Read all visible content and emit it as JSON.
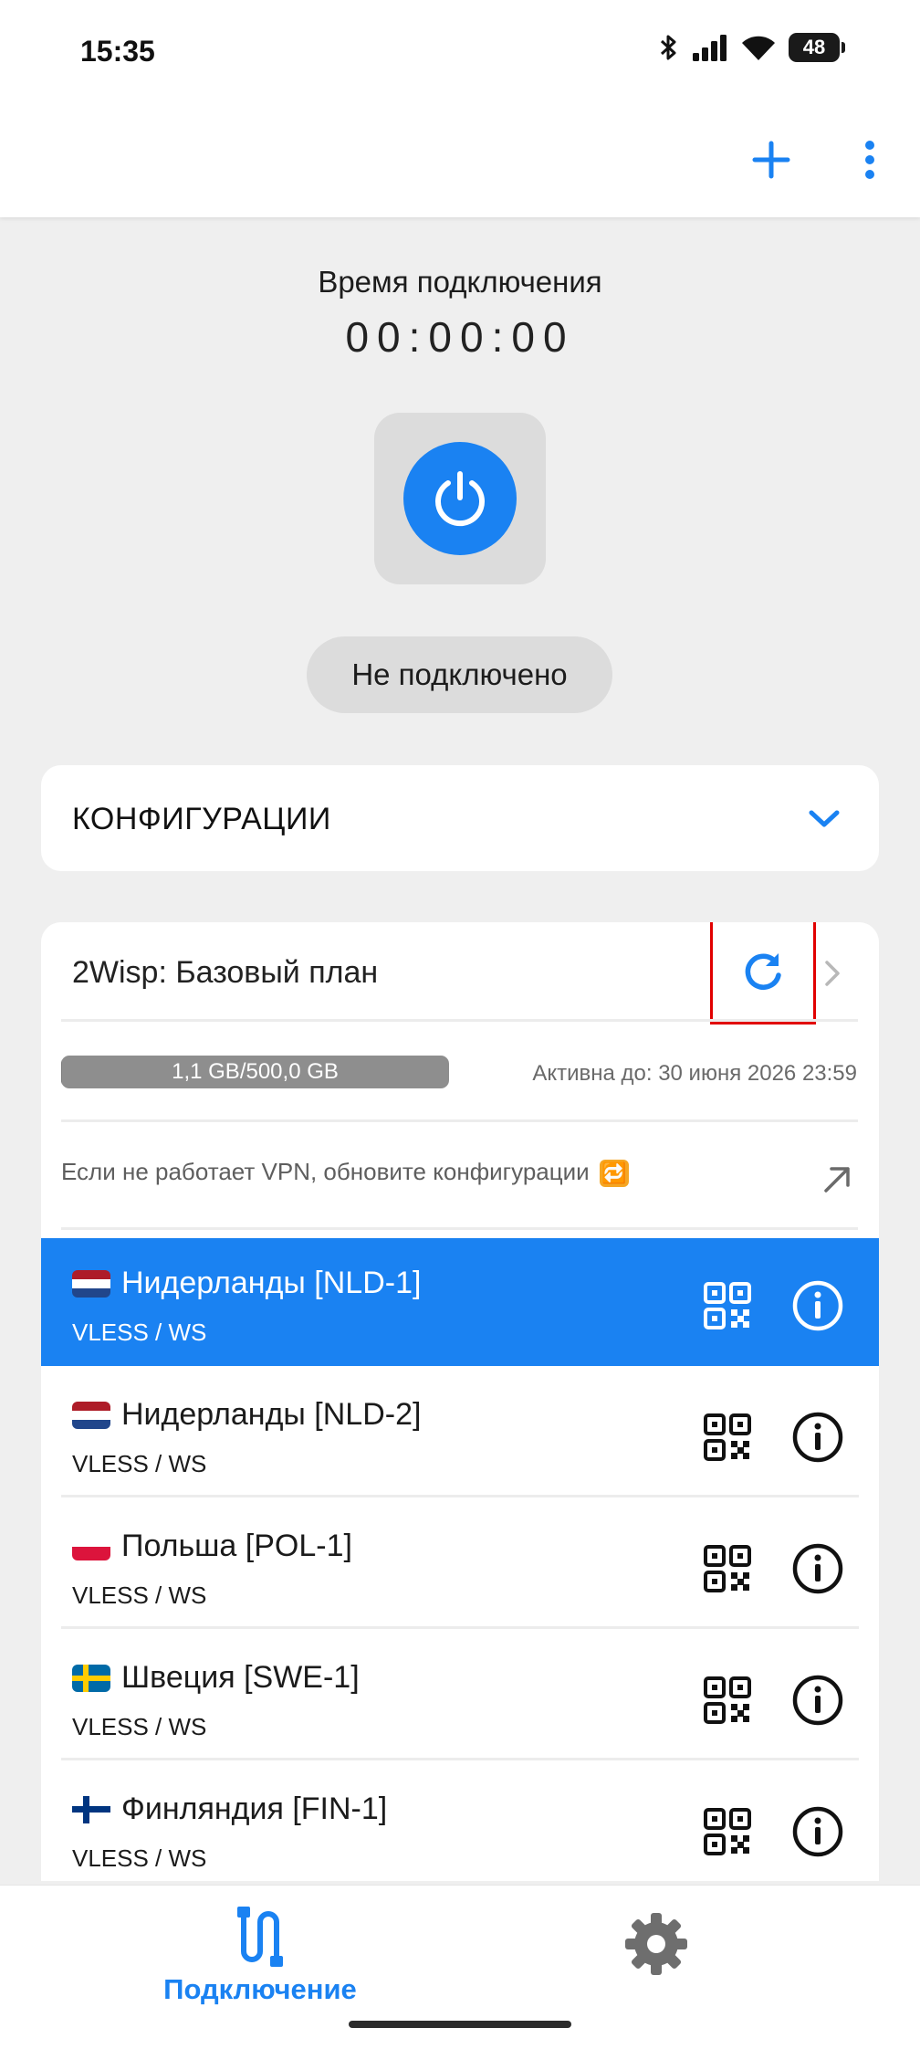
{
  "status_bar": {
    "time": "15:35",
    "battery": "48"
  },
  "header": {
    "add_icon": "plus-icon",
    "menu_icon": "more-vert-icon"
  },
  "connection": {
    "label": "Время подключения",
    "timer": "00:00:00",
    "status": "Не подключено",
    "accent_color": "#1a82f2"
  },
  "configs": {
    "title": "КОНФИГУРАЦИИ"
  },
  "subscription": {
    "name": "2Wisp: Базовый план",
    "usage_text": "1,1 GB/500,0 GB",
    "usage_fraction": 0.0022,
    "active_until": "Активна до: 30 июня 2026 23:59",
    "hint": "Если не работает VPN, обновите конфигурации",
    "hint_emoji": "🔁"
  },
  "servers": [
    {
      "name": "Нидерланды [NLD-1]",
      "protocol": "VLESS / WS",
      "flag": "nl",
      "selected": true
    },
    {
      "name": "Нидерланды [NLD-2]",
      "protocol": "VLESS / WS",
      "flag": "nl",
      "selected": false
    },
    {
      "name": "Польша [POL-1]",
      "protocol": "VLESS / WS",
      "flag": "pl",
      "selected": false
    },
    {
      "name": "Швеция [SWE-1]",
      "protocol": "VLESS / WS",
      "flag": "se",
      "selected": false
    },
    {
      "name": "Финляндия [FIN-1]",
      "protocol": "VLESS / WS",
      "flag": "fi",
      "selected": false
    }
  ],
  "nav": {
    "connection_label": "Подключение"
  }
}
